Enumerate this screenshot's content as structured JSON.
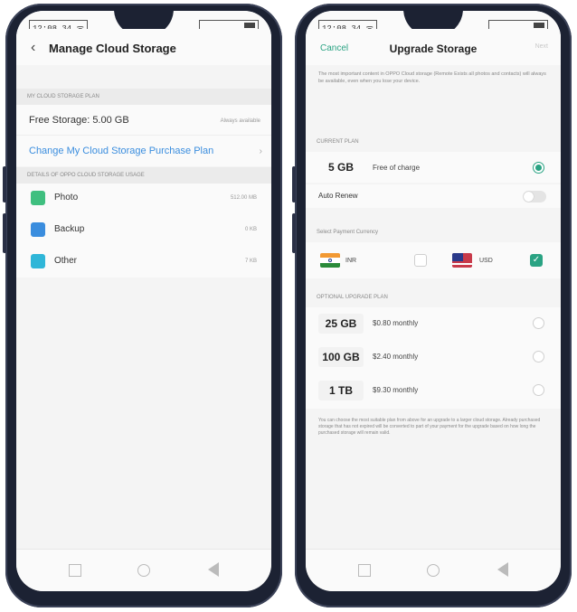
{
  "left": {
    "status_time": "12:08 34 ᯤ",
    "title": "Manage Cloud Storage",
    "plan_header": "MY CLOUD STORAGE PLAN",
    "free_storage_label": "Free Storage: 5.00 GB",
    "free_storage_status": "Always available",
    "change_plan_link": "Change My Cloud Storage Purchase Plan",
    "details_header": "DETAILS OF OPPO CLOUD STORAGE USAGE",
    "usage": [
      {
        "label": "Photo",
        "size": "512.00 MB",
        "icon": "photo-icon",
        "color": "#3fbf7f"
      },
      {
        "label": "Backup",
        "size": "0 KB",
        "icon": "backup-icon",
        "color": "#3a8dde"
      },
      {
        "label": "Other",
        "size": "7 KB",
        "icon": "other-icon",
        "color": "#2fb6d8"
      }
    ]
  },
  "right": {
    "status_time": "12:08 34 ᯤ",
    "cancel": "Cancel",
    "title": "Upgrade Storage",
    "next": "Next",
    "description": "The most important content in OPPO Cloud storage (Remote Exists all photos and contacts) will always be available, even when you lose your device.",
    "current_plan_header": "CURRENT PLAN",
    "current_plan_size": "5 GB",
    "current_plan_desc": "Free of charge",
    "auto_renew": "Auto Renew",
    "currency_header": "Select Payment Currency",
    "currencies": [
      {
        "code": "INR",
        "selected": false,
        "flag": "india-flag-icon"
      },
      {
        "code": "USD",
        "selected": true,
        "flag": "usa-flag-icon"
      }
    ],
    "upgrade_header": "OPTIONAL UPGRADE PLAN",
    "plans": [
      {
        "size": "25 GB",
        "price": "$0.80 monthly"
      },
      {
        "size": "100 GB",
        "price": "$2.40 monthly"
      },
      {
        "size": "1 TB",
        "price": "$9.30 monthly"
      }
    ],
    "footnote": "You can choose the most suitable plan from above for an upgrade to a larger cloud storage. Already purchased storage that has not expired will be converted to part of your payment for the upgrade based on how long the purchased storage will remain valid."
  },
  "colors": {
    "accent": "#2aa383",
    "link": "#3a8dde",
    "phone_frame": "#1c2233"
  }
}
